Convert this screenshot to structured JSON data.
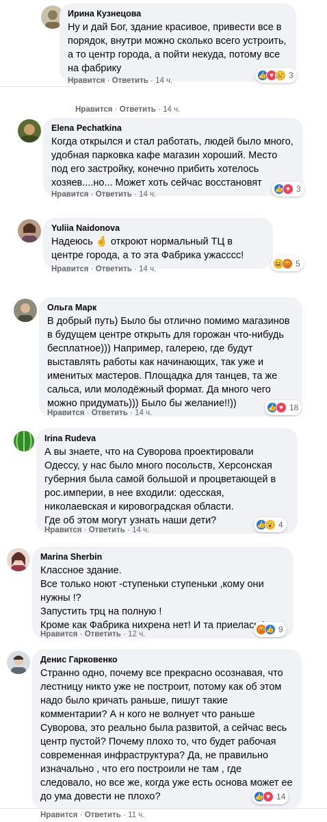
{
  "orphan_actions": {
    "like": "Нравится",
    "reply": "Ответить",
    "sep": " · ",
    "time": "14 ч."
  },
  "comments": [
    {
      "author": "Ирина Кузнецова",
      "text": "Ну и дай Бог, здание красивое, привести все в порядок, внутри можно сколько всего устроить, а то центр города, а пойти некуда, потому все на фабрику",
      "like": "Нравится",
      "reply": "Ответить",
      "sep": " · ",
      "time": "14 ч.",
      "reactions_count": "3",
      "reactions": [
        "like",
        "love",
        "sad"
      ]
    },
    {
      "author": "Elena Pechatkina",
      "text": "Когда открылся и стал работать, людей было много, удобная парковка кафе магазин хороший. Место под его застройку, конечно прибить хотелось хозяев....но... Может хоть сейчас восстановят",
      "like": "Нравится",
      "reply": "Ответить",
      "sep": " · ",
      "time": "14 ч.",
      "reactions_count": "3",
      "reactions": [
        "like",
        "love"
      ]
    },
    {
      "author": "Yuliia Naidonova",
      "text": "Надеюсь 🤞 откроют нормальный ТЦ в центре города, а то эта Фабрика ужасссс!",
      "like": "Нравится",
      "reply": "Ответить",
      "sep": " · ",
      "time": "14 ч.",
      "reactions_count": "5",
      "reactions": [
        "haha",
        "angry"
      ]
    },
    {
      "author": "Ольга Марк",
      "text": "В добрый путь) Было бы отлично помимо магазинов в будущем центре открыть для горожан что-нибудь бесплатное))) Например, галерею, где будут выставлять работы как начинающих, так уже и именитых мастеров. Площадка для танцев, та же сальса, или молодёжный формат. Да много чего можно придумать))) Было бы желание!!))",
      "like": "Нравится",
      "reply": "Ответить",
      "sep": " · ",
      "time": "14 ч.",
      "reactions_count": "18",
      "reactions": [
        "like",
        "love"
      ]
    },
    {
      "author": "Irina Rudeva",
      "text": "А вы знаете, что на Суворова проектировали Одессу, у нас было много посольств, Херсонская губерния была самой большой и процветающей в рос.империи, в нее входили: одесская, николаевская и кировоградская области.\nГде об этом могут узнать наши дети?",
      "like": "Нравится",
      "reply": "Ответить",
      "sep": " · ",
      "time": "14 ч.",
      "reactions_count": "4",
      "reactions": [
        "like",
        "wow"
      ]
    },
    {
      "author": "Marina Sherbin",
      "text": "Классное здание.\nВсе только ноют -ступеньки ступеньки ,кому они нужны !?\nЗапустить трц на полную !\nКроме как Фабрика нихрена нет! И та приелась !",
      "like": "Нравится",
      "reply": "Ответить",
      "sep": " · ",
      "time": "12 ч.",
      "reactions_count": "9",
      "reactions": [
        "angry",
        "like"
      ]
    },
    {
      "author": "Денис Гарковенко",
      "text": "Странно одно, почему все прекрасно осознавая, что лестницу никто уже не построит, потому как об этом надо было кричать раньше, пишут такие комментарии? А н кого не волнует что раньше Суворова, это реально была развитой, а сейчас весь центр пустой? Почему плохо то, что будет рабочая современная инфраструктура? Да, не правильно изначально , что его построили не там , где следовало, но все же, когда уже есть основа может ее до ума довести не плохо?",
      "like": "Нравится",
      "reply": "Ответить",
      "sep": " · ",
      "time": "11 ч.",
      "reactions_count": "14",
      "reactions": [
        "like",
        "love"
      ]
    }
  ],
  "colors": {
    "bubble": "#f0f2f5",
    "meta": "#65676b",
    "like": "#1877f2",
    "love": "#f33e58",
    "emoji": "#f7b125",
    "angry": "#e9710f"
  }
}
